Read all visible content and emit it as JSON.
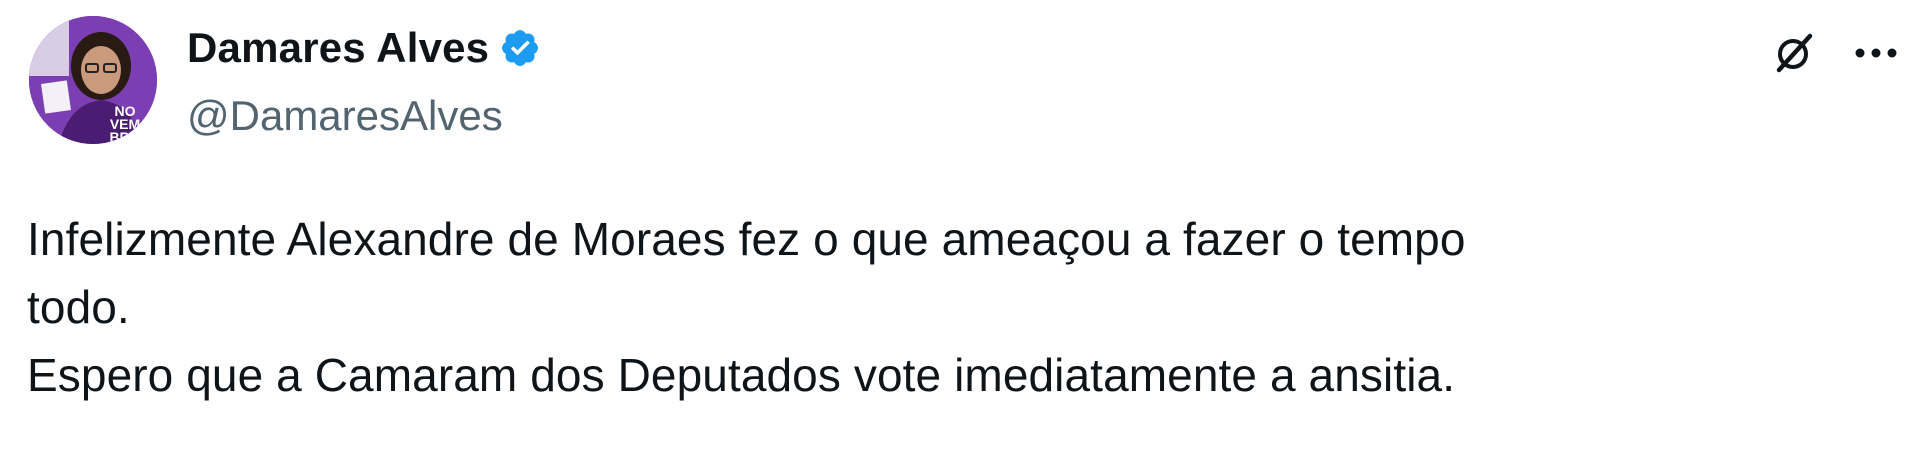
{
  "author": {
    "display_name": "Damares Alves",
    "handle": "@DamaresAlves",
    "verified": true,
    "avatar_badge": [
      "NO",
      "VEM",
      "BRO"
    ]
  },
  "actions": {
    "grok_icon": "grok-icon",
    "more_icon": "more-icon"
  },
  "tweet": {
    "lines": [
      "Infelizmente Alexandre de Moraes fez o que ameaçou a fazer o tempo",
      "todo.",
      "Espero que a Camaram dos Deputados vote imediatamente a ansitia."
    ]
  },
  "colors": {
    "text": "#0f1419",
    "secondary": "#536471",
    "verified_blue": "#1d9bf0",
    "avatar_purple": "#7b3fb0"
  }
}
